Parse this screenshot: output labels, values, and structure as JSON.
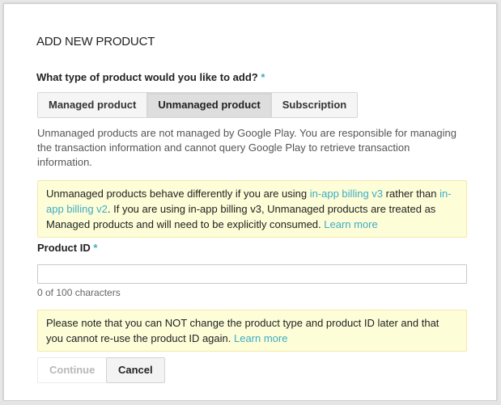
{
  "dialog": {
    "title": "ADD NEW PRODUCT",
    "product_type": {
      "label": "What type of product would you like to add?",
      "required_marker": "*",
      "options": [
        {
          "label": "Managed product",
          "selected": false
        },
        {
          "label": "Unmanaged product",
          "selected": true
        },
        {
          "label": "Subscription",
          "selected": false
        }
      ],
      "description": "Unmanaged products are not managed by Google Play. You are responsible for managing the transaction information and cannot query Google Play to retrieve transaction information."
    },
    "billing_note": {
      "text_1": "Unmanaged products behave differently if you are using ",
      "link_v3": "in-app billing v3",
      "text_2": " rather than ",
      "link_v2": "in-app billing v2",
      "text_3": ". If you are using in-app billing v3, Unmanaged products are treated as Managed products and will need to be explicitly consumed. ",
      "learn_more": "Learn more"
    },
    "product_id": {
      "label": "Product ID",
      "required_marker": "*",
      "value": "",
      "placeholder": "",
      "counter": "0 of 100 characters"
    },
    "warning_note": {
      "text": "Please note that you can NOT change the product type and product ID later and that you cannot re-use the product ID again. ",
      "learn_more": "Learn more"
    },
    "buttons": {
      "continue": "Continue",
      "continue_disabled": true,
      "cancel": "Cancel"
    },
    "colors": {
      "accent_link": "#3eabc4",
      "note_background": "#fdfdd8",
      "note_border": "#f5e9a8"
    }
  }
}
